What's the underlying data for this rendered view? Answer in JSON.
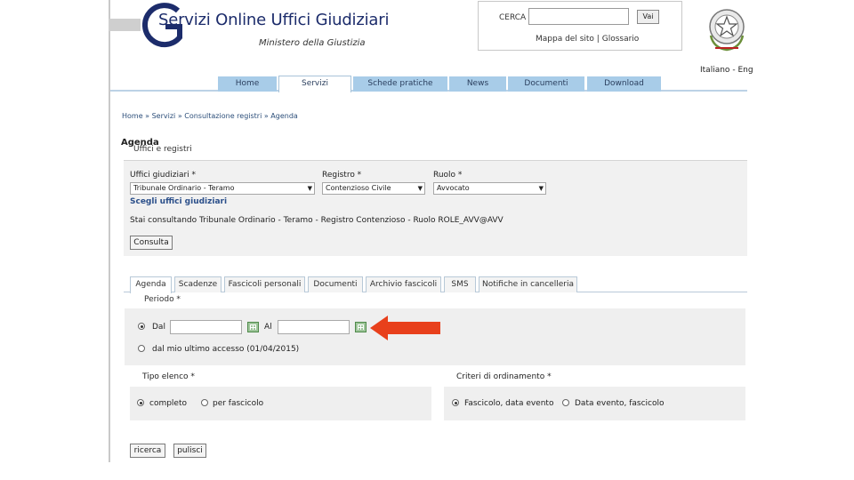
{
  "header": {
    "title": "Servizi Online Uffici Giudiziari",
    "subtitle": "Ministero della Giustizia",
    "search_label": "CERCA",
    "search_value": "",
    "search_button": "Vai",
    "map_link": "Mappa del sito",
    "separator": "|",
    "glossary_link": "Glossario",
    "lang_it": "Italiano",
    "lang_sep": "-",
    "lang_en": "Eng"
  },
  "nav": {
    "tabs": [
      {
        "label": "Home"
      },
      {
        "label": "Servizi"
      },
      {
        "label": "Schede pratiche"
      },
      {
        "label": "News"
      },
      {
        "label": "Documenti"
      },
      {
        "label": "Download"
      }
    ],
    "active": "Servizi"
  },
  "breadcrumb": "Home » Servizi » Consultazione registri » Agenda",
  "page_title": "Agenda",
  "uffici_section": {
    "title": "Uffici e registri",
    "ufficio_label": "Uffici giudiziari *",
    "ufficio_value": "Tribunale Ordinario - Teramo",
    "registro_label": "Registro *",
    "registro_value": "Contenzioso Civile",
    "ruolo_label": "Ruolo *",
    "ruolo_value": "Avvocato",
    "scegli_link": "Scegli uffici giudiziari",
    "status": "Stai consultando Tribunale Ordinario - Teramo - Registro Contenzioso - Ruolo ROLE_AVV@AVV",
    "consulta_button": "Consulta"
  },
  "tabs": [
    {
      "label": "Agenda"
    },
    {
      "label": "Scadenze"
    },
    {
      "label": "Fascicoli personali"
    },
    {
      "label": "Documenti"
    },
    {
      "label": "Archivio fascicoli"
    },
    {
      "label": "SMS"
    },
    {
      "label": "Notifiche in cancelleria"
    }
  ],
  "periodo": {
    "label": "Periodo *",
    "dal_label": "Dal",
    "al_label": "Al",
    "dal_value": "",
    "al_value": "",
    "last_access": "dal mio ultimo accesso (01/04/2015)"
  },
  "tipo_elenco": {
    "label": "Tipo elenco *",
    "option1": "completo",
    "option2": "per fascicolo"
  },
  "criteri": {
    "label": "Criteri di ordinamento *",
    "option1": "Fascicolo, data evento",
    "option2": "Data evento, fascicolo"
  },
  "actions": {
    "ricerca": "ricerca",
    "pulisci": "pulisci"
  },
  "colors": {
    "nav_tab": "#a8cce8",
    "brand_blue": "#1c2c6b",
    "arrow": "#e8401c"
  }
}
